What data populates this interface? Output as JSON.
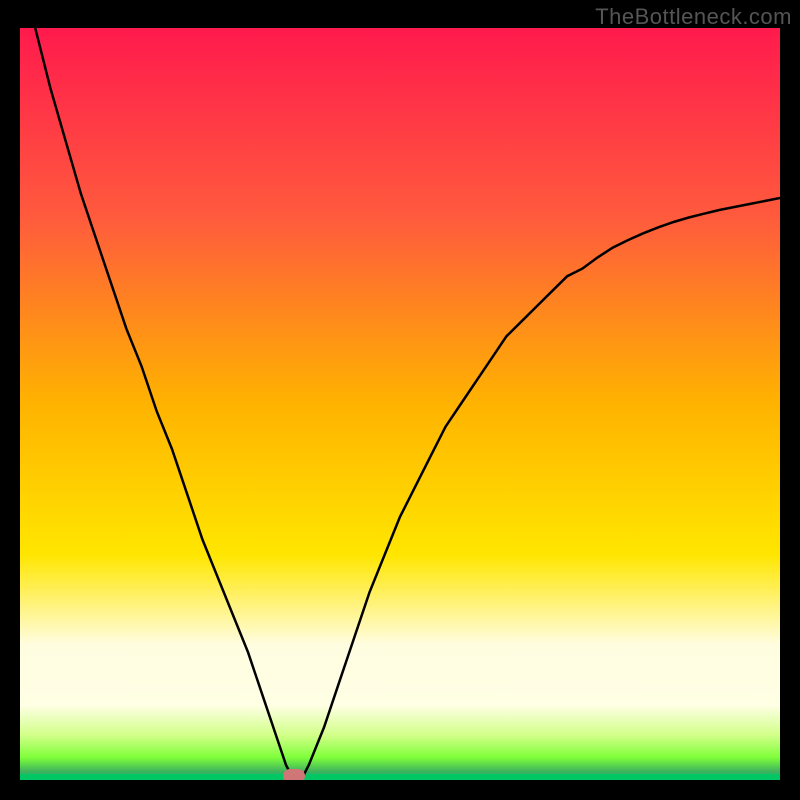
{
  "attribution": "TheBottleneck.com",
  "chart_data": {
    "type": "line",
    "title": "",
    "xlabel": "",
    "ylabel": "",
    "xlim": [
      0,
      100
    ],
    "ylim": [
      0,
      100
    ],
    "series": [
      {
        "name": "curve",
        "x": [
          2,
          4,
          6,
          8,
          10,
          12,
          14,
          16,
          18,
          20,
          22,
          24,
          26,
          28,
          30,
          32,
          34,
          35,
          36,
          37,
          38,
          40,
          42,
          44,
          46,
          48,
          50,
          52,
          54,
          56,
          58,
          60,
          62,
          64,
          66,
          68,
          70,
          72,
          74,
          76,
          78,
          80,
          82,
          84,
          86,
          88,
          90,
          92,
          94,
          96,
          98,
          100
        ],
        "values": [
          100,
          92,
          85,
          78,
          72,
          66,
          60,
          55,
          49,
          44,
          38,
          32,
          27,
          22,
          17,
          11,
          5,
          2,
          0,
          0,
          2,
          7,
          13,
          19,
          25,
          30,
          35,
          39,
          43,
          47,
          50,
          53,
          56,
          59,
          61,
          63,
          65,
          67,
          68,
          69.5,
          70.8,
          71.8,
          72.7,
          73.5,
          74.2,
          74.8,
          75.3,
          75.8,
          76.2,
          76.6,
          77,
          77.4
        ]
      }
    ],
    "annotations": [
      {
        "name": "minimum-marker",
        "x": 36,
        "y": 0
      }
    ]
  },
  "colors": {
    "curve": "#000000",
    "marker": "#cf7777",
    "gradient_top": "#ff1a4d",
    "gradient_bottom": "#00e676",
    "attribution": "#555555"
  }
}
